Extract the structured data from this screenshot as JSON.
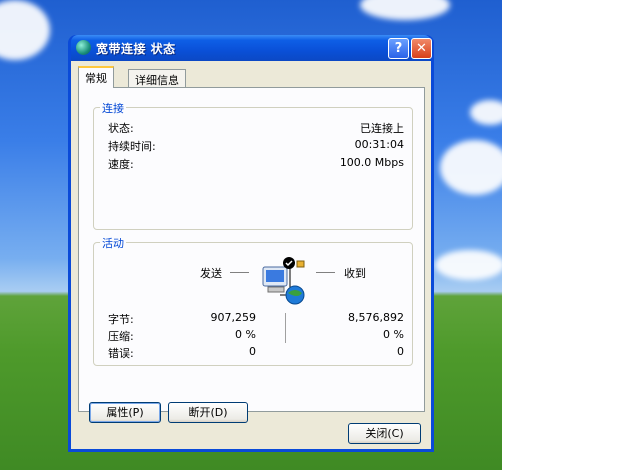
{
  "window": {
    "title": "宽带连接 状态",
    "help_label": "?",
    "close_label": "✕"
  },
  "tabs": [
    {
      "label": "常规",
      "active": true
    },
    {
      "label": "详细信息",
      "active": false
    }
  ],
  "connection": {
    "title": "连接",
    "rows": [
      {
        "label": "状态:",
        "value": "已连接上"
      },
      {
        "label": "持续时间:",
        "value": "00:31:04"
      },
      {
        "label": "速度:",
        "value": "100.0 Mbps"
      }
    ]
  },
  "activity": {
    "title": "活动",
    "sent_label": "发送",
    "received_label": "收到",
    "rows": [
      {
        "label": "字节:",
        "sent": "907,259",
        "received": "8,576,892"
      },
      {
        "label": "压缩:",
        "sent": "0 %",
        "received": "0 %"
      },
      {
        "label": "错误:",
        "sent": "0",
        "received": "0"
      }
    ]
  },
  "buttons": {
    "properties": "属性(P)",
    "disconnect": "断开(D)",
    "close": "关闭(C)"
  },
  "colors": {
    "titlebar": "#0a50d8",
    "group_title": "#0046d5",
    "dialog_bg": "#ece9d8"
  }
}
